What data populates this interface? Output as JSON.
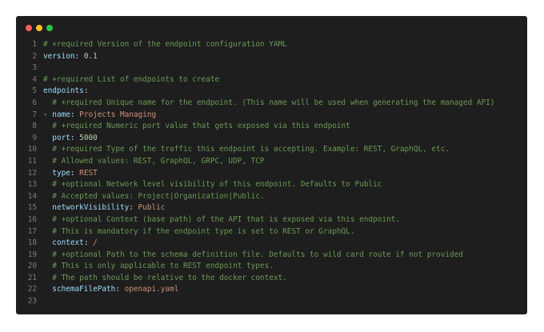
{
  "window": {
    "controls": {
      "close_color": "#ff5f57",
      "minimize_color": "#febc2e",
      "maximize_color": "#28c840"
    }
  },
  "colors": {
    "background": "#1e1e1e",
    "comment": "#6a9955",
    "key": "#9cdcfe",
    "string": "#ce9178",
    "number": "#b5cea8",
    "line_number": "#7c7c7c"
  },
  "lines": [
    {
      "n": "1",
      "tokens": [
        {
          "t": "comment",
          "v": "# +required Version of the endpoint configuration YAML"
        }
      ]
    },
    {
      "n": "2",
      "tokens": [
        {
          "t": "key",
          "v": "version"
        },
        {
          "t": "punct",
          "v": ": "
        },
        {
          "t": "number",
          "v": "0.1"
        }
      ]
    },
    {
      "n": "3",
      "tokens": []
    },
    {
      "n": "4",
      "tokens": [
        {
          "t": "comment",
          "v": "# +required List of endpoints to create"
        }
      ]
    },
    {
      "n": "5",
      "tokens": [
        {
          "t": "key",
          "v": "endpoints"
        },
        {
          "t": "punct",
          "v": ":"
        }
      ]
    },
    {
      "n": "6",
      "tokens": [
        {
          "t": "punct",
          "v": "  "
        },
        {
          "t": "comment",
          "v": "# +required Unique name for the endpoint. (This name will be used when generating the managed API)"
        }
      ]
    },
    {
      "n": "7",
      "tokens": [
        {
          "t": "dash",
          "v": "- "
        },
        {
          "t": "key",
          "v": "name"
        },
        {
          "t": "punct",
          "v": ": "
        },
        {
          "t": "string",
          "v": "Projects Managing"
        }
      ]
    },
    {
      "n": "8",
      "tokens": [
        {
          "t": "punct",
          "v": "  "
        },
        {
          "t": "comment",
          "v": "# +required Numeric port value that gets exposed via this endpoint"
        }
      ]
    },
    {
      "n": "9",
      "tokens": [
        {
          "t": "punct",
          "v": "  "
        },
        {
          "t": "key",
          "v": "port"
        },
        {
          "t": "punct",
          "v": ": "
        },
        {
          "t": "number",
          "v": "5000"
        }
      ]
    },
    {
      "n": "10",
      "tokens": [
        {
          "t": "punct",
          "v": "  "
        },
        {
          "t": "comment",
          "v": "# +required Type of the traffic this endpoint is accepting. Example: REST, GraphQL, etc."
        }
      ]
    },
    {
      "n": "11",
      "tokens": [
        {
          "t": "punct",
          "v": "  "
        },
        {
          "t": "comment",
          "v": "# Allowed values: REST, GraphQL, GRPC, UDP, TCP"
        }
      ]
    },
    {
      "n": "12",
      "tokens": [
        {
          "t": "punct",
          "v": "  "
        },
        {
          "t": "key",
          "v": "type"
        },
        {
          "t": "punct",
          "v": ": "
        },
        {
          "t": "string",
          "v": "REST"
        }
      ]
    },
    {
      "n": "13",
      "tokens": [
        {
          "t": "punct",
          "v": "  "
        },
        {
          "t": "comment",
          "v": "# +optional Network level visibility of this endpoint. Defaults to Public"
        }
      ]
    },
    {
      "n": "14",
      "tokens": [
        {
          "t": "punct",
          "v": "  "
        },
        {
          "t": "comment",
          "v": "# Accepted values: Project|Organization|Public."
        }
      ]
    },
    {
      "n": "15",
      "tokens": [
        {
          "t": "punct",
          "v": "  "
        },
        {
          "t": "key",
          "v": "networkVisibility"
        },
        {
          "t": "punct",
          "v": ": "
        },
        {
          "t": "string",
          "v": "Public"
        }
      ]
    },
    {
      "n": "16",
      "tokens": [
        {
          "t": "punct",
          "v": "  "
        },
        {
          "t": "comment",
          "v": "# +optional Context (base path) of the API that is exposed via this endpoint."
        }
      ]
    },
    {
      "n": "17",
      "tokens": [
        {
          "t": "punct",
          "v": "  "
        },
        {
          "t": "comment",
          "v": "# This is mandatory if the endpoint type is set to REST or GraphQL."
        }
      ]
    },
    {
      "n": "18",
      "tokens": [
        {
          "t": "punct",
          "v": "  "
        },
        {
          "t": "key",
          "v": "context"
        },
        {
          "t": "punct",
          "v": ": "
        },
        {
          "t": "string",
          "v": "/"
        }
      ]
    },
    {
      "n": "19",
      "tokens": [
        {
          "t": "punct",
          "v": "  "
        },
        {
          "t": "comment",
          "v": "# +optional Path to the schema definition file. Defaults to wild card route if not provided"
        }
      ]
    },
    {
      "n": "20",
      "tokens": [
        {
          "t": "punct",
          "v": "  "
        },
        {
          "t": "comment",
          "v": "# This is only applicable to REST endpoint types."
        }
      ]
    },
    {
      "n": "21",
      "tokens": [
        {
          "t": "punct",
          "v": "  "
        },
        {
          "t": "comment",
          "v": "# The path should be relative to the docker context."
        }
      ]
    },
    {
      "n": "22",
      "tokens": [
        {
          "t": "punct",
          "v": "  "
        },
        {
          "t": "key",
          "v": "schemaFilePath"
        },
        {
          "t": "punct",
          "v": ": "
        },
        {
          "t": "string",
          "v": "openapi.yaml"
        }
      ]
    },
    {
      "n": "23",
      "tokens": []
    }
  ]
}
